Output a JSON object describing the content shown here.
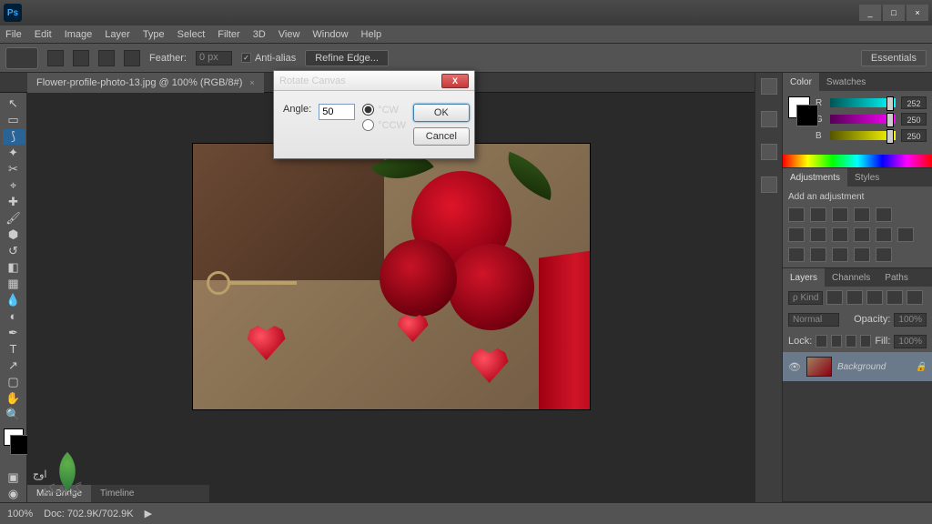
{
  "app": {
    "logo": "Ps"
  },
  "window": {
    "minimize": "_",
    "maximize": "□",
    "close": "×"
  },
  "menu": [
    "File",
    "Edit",
    "Image",
    "Layer",
    "Type",
    "Select",
    "Filter",
    "3D",
    "View",
    "Window",
    "Help"
  ],
  "options": {
    "feather_label": "Feather:",
    "feather_value": "0 px",
    "antialias": "Anti-alias",
    "refine": "Refine Edge...",
    "essentials": "Essentials"
  },
  "doc": {
    "tab": "Flower-profile-photo-13.jpg @ 100% (RGB/8#)",
    "close": "×"
  },
  "dialog": {
    "title": "Rotate Canvas",
    "angle_label": "Angle:",
    "angle_value": "50",
    "cw": "°CW",
    "ccw": "°CCW",
    "ok": "OK",
    "cancel": "Cancel"
  },
  "panels": {
    "color": {
      "tab1": "Color",
      "tab2": "Swatches",
      "r": "R",
      "g": "G",
      "b": "B",
      "rv": "252",
      "gv": "250",
      "bv": "250"
    },
    "adjust": {
      "tab1": "Adjustments",
      "tab2": "Styles",
      "hint": "Add an adjustment"
    },
    "layers": {
      "tab1": "Layers",
      "tab2": "Channels",
      "tab3": "Paths",
      "kind": "ρ Kind",
      "blend": "Normal",
      "opacity_label": "Opacity:",
      "opacity": "100%",
      "lock": "Lock:",
      "fill_label": "Fill:",
      "fill": "100%",
      "bg": "Background"
    }
  },
  "status": {
    "zoom": "100%",
    "doc": "Doc: 702.9K/702.9K"
  },
  "bottom": {
    "tab1": "Mini Bridge",
    "tab2": "Timeline"
  },
  "watermark": {
    "main": "اوج",
    "sub": "گرافیک"
  }
}
